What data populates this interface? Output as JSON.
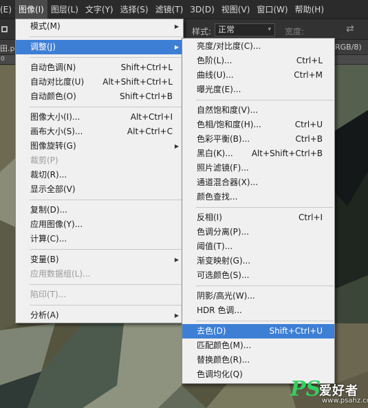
{
  "menubar": {
    "items": [
      "(E)",
      "图像(I)",
      "图层(L)",
      "文字(Y)",
      "选择(S)",
      "滤镜(T)",
      "3D(D)",
      "视图(V)",
      "窗口(W)",
      "帮助(H)"
    ],
    "active_index": 1
  },
  "options": {
    "style_label": "样式:",
    "style_value": "正常",
    "width_label": "宽度:"
  },
  "doc": {
    "tab_left": "田.p",
    "tab_right": "RGB/8)",
    "ruler_left": "0"
  },
  "image_menu": {
    "items": [
      {
        "label": "模式(M)",
        "submenu": true
      },
      {
        "sep": true
      },
      {
        "label": "调整(J)",
        "submenu": true,
        "highlighted": true
      },
      {
        "sep": true
      },
      {
        "label": "自动色调(N)",
        "shortcut": "Shift+Ctrl+L"
      },
      {
        "label": "自动对比度(U)",
        "shortcut": "Alt+Shift+Ctrl+L"
      },
      {
        "label": "自动颜色(O)",
        "shortcut": "Shift+Ctrl+B"
      },
      {
        "sep": true
      },
      {
        "label": "图像大小(I)...",
        "shortcut": "Alt+Ctrl+I"
      },
      {
        "label": "画布大小(S)...",
        "shortcut": "Alt+Ctrl+C"
      },
      {
        "label": "图像旋转(G)",
        "submenu": true
      },
      {
        "label": "裁剪(P)",
        "disabled": true
      },
      {
        "label": "裁切(R)..."
      },
      {
        "label": "显示全部(V)"
      },
      {
        "sep": true
      },
      {
        "label": "复制(D)..."
      },
      {
        "label": "应用图像(Y)..."
      },
      {
        "label": "计算(C)..."
      },
      {
        "sep": true
      },
      {
        "label": "变量(B)",
        "submenu": true
      },
      {
        "label": "应用数据组(L)...",
        "disabled": true
      },
      {
        "sep": true
      },
      {
        "label": "陷印(T)...",
        "disabled": true
      },
      {
        "sep": true
      },
      {
        "label": "分析(A)",
        "submenu": true
      }
    ]
  },
  "adjust_menu": {
    "items": [
      {
        "label": "亮度/对比度(C)..."
      },
      {
        "label": "色阶(L)...",
        "shortcut": "Ctrl+L"
      },
      {
        "label": "曲线(U)...",
        "shortcut": "Ctrl+M"
      },
      {
        "label": "曝光度(E)..."
      },
      {
        "sep": true
      },
      {
        "label": "自然饱和度(V)..."
      },
      {
        "label": "色相/饱和度(H)...",
        "shortcut": "Ctrl+U"
      },
      {
        "label": "色彩平衡(B)...",
        "shortcut": "Ctrl+B"
      },
      {
        "label": "黑白(K)...",
        "shortcut": "Alt+Shift+Ctrl+B"
      },
      {
        "label": "照片滤镜(F)..."
      },
      {
        "label": "通道混合器(X)..."
      },
      {
        "label": "颜色查找..."
      },
      {
        "sep": true
      },
      {
        "label": "反相(I)",
        "shortcut": "Ctrl+I"
      },
      {
        "label": "色调分离(P)..."
      },
      {
        "label": "阈值(T)..."
      },
      {
        "label": "渐变映射(G)..."
      },
      {
        "label": "可选颜色(S)..."
      },
      {
        "sep": true
      },
      {
        "label": "阴影/高光(W)..."
      },
      {
        "label": "HDR 色调..."
      },
      {
        "sep": true
      },
      {
        "label": "去色(D)",
        "shortcut": "Shift+Ctrl+U",
        "highlighted": true
      },
      {
        "label": "匹配颜色(M)..."
      },
      {
        "label": "替换颜色(R)..."
      },
      {
        "label": "色调均化(Q)"
      }
    ]
  },
  "watermark": {
    "logo": "PS",
    "text": "爱好者",
    "url": "www.psahz.com"
  },
  "colors": {
    "menu_bg": "#f0f0f0",
    "highlight": "#3e7fd6",
    "menubar_bg": "#2b2b2b"
  }
}
